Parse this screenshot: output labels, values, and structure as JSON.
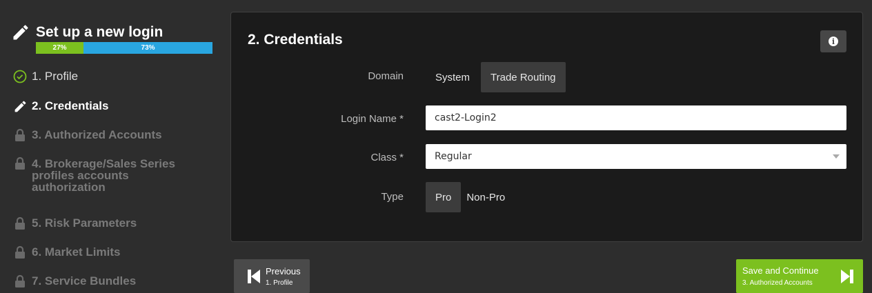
{
  "sidebar": {
    "title": "Set up a new login",
    "progress": {
      "done_label": "27%",
      "remaining_label": "73%",
      "done_fraction": 0.27
    },
    "steps": [
      {
        "label": "1. Profile",
        "state": "complete",
        "icon": "check-circle-icon"
      },
      {
        "label": "2. Credentials",
        "state": "current",
        "icon": "pencil-icon"
      },
      {
        "label": "3. Authorized Accounts",
        "state": "locked",
        "icon": "lock-icon"
      },
      {
        "label_lines": [
          "4. Brokerage/Sales Series",
          "profiles accounts",
          "authorization"
        ],
        "state": "locked",
        "icon": "lock-icon"
      },
      {
        "label": "5. Risk Parameters",
        "state": "locked",
        "icon": "lock-icon"
      },
      {
        "label": "6. Market Limits",
        "state": "locked",
        "icon": "lock-icon"
      },
      {
        "label": "7. Service Bundles",
        "state": "locked",
        "icon": "lock-icon"
      }
    ]
  },
  "panel": {
    "title": "2. Credentials",
    "info_icon": "info-icon",
    "domain": {
      "label": "Domain",
      "options": [
        "System",
        "Trade Routing"
      ],
      "selected": "Trade Routing"
    },
    "login_name": {
      "label": "Login Name *",
      "value": "cast2-Login2"
    },
    "class_field": {
      "label": "Class *",
      "value": "Regular"
    },
    "type": {
      "label": "Type",
      "options": [
        "Pro",
        "Non-Pro"
      ],
      "selected": "Pro"
    }
  },
  "footer": {
    "previous": {
      "label": "Previous",
      "sublabel": "1. Profile"
    },
    "next": {
      "label": "Save and Continue",
      "sublabel": "3. Authorized Accounts"
    }
  },
  "colors": {
    "accent_green": "#7cc01f",
    "progress_blue": "#29a6e0",
    "panel_bg": "#1b1b1b",
    "page_bg": "#2d2d2d"
  }
}
